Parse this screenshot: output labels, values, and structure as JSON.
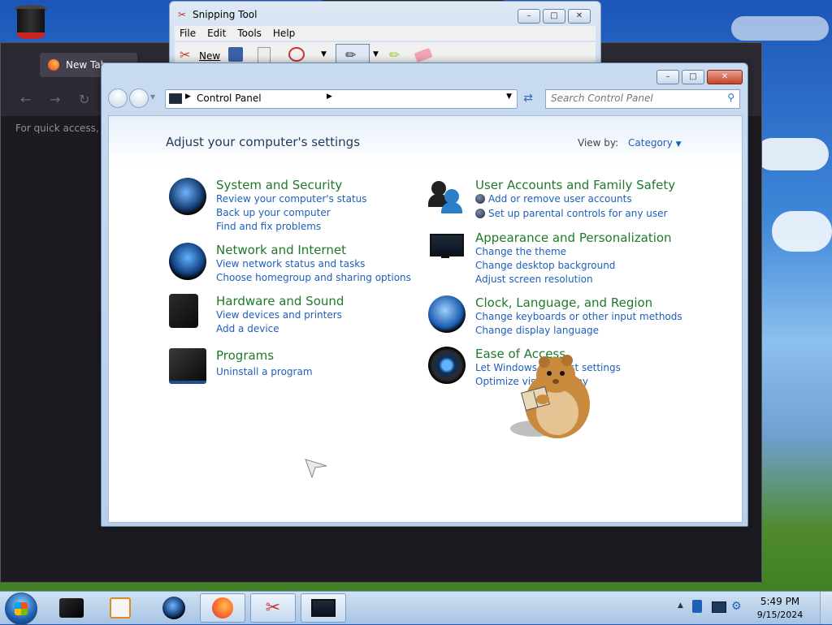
{
  "firefox": {
    "tab_label": "New Tab",
    "quick_access_text": "For quick access, pla"
  },
  "snipping_tool": {
    "title": "Snipping Tool",
    "menu": [
      "File",
      "Edit",
      "Tools",
      "Help"
    ],
    "new_label": "New"
  },
  "control_panel": {
    "breadcrumb": "Control Panel",
    "search_placeholder": "Search Control Panel",
    "heading": "Adjust your computer's settings",
    "view_by_label": "View by:",
    "view_by_value": "Category",
    "categories": [
      {
        "title": "System and Security",
        "links": [
          "Review your computer's status",
          "Back up your computer",
          "Find and fix problems"
        ]
      },
      {
        "title": "Network and Internet",
        "links": [
          "View network status and tasks",
          "Choose homegroup and sharing options"
        ]
      },
      {
        "title": "Hardware and Sound",
        "links": [
          "View devices and printers",
          "Add a device"
        ]
      },
      {
        "title": "Programs",
        "links": [
          "Uninstall a program"
        ]
      },
      {
        "title": "User Accounts and Family Safety",
        "links": [
          "Add or remove user accounts",
          "Set up parental controls for any user"
        ]
      },
      {
        "title": "Appearance and Personalization",
        "links": [
          "Change the theme",
          "Change desktop background",
          "Adjust screen resolution"
        ]
      },
      {
        "title": "Clock, Language, and Region",
        "links": [
          "Change keyboards or other input methods",
          "Change display language"
        ]
      },
      {
        "title": "Ease of Access",
        "links": [
          "Let Windows suggest settings",
          "Optimize visual display"
        ]
      }
    ]
  },
  "taskbar": {
    "time": "5:49 PM",
    "date": "9/15/2024"
  },
  "colors": {
    "link_blue": "#1e5fb8",
    "category_green": "#1d7a2a",
    "heading_navy": "#1e395b"
  }
}
